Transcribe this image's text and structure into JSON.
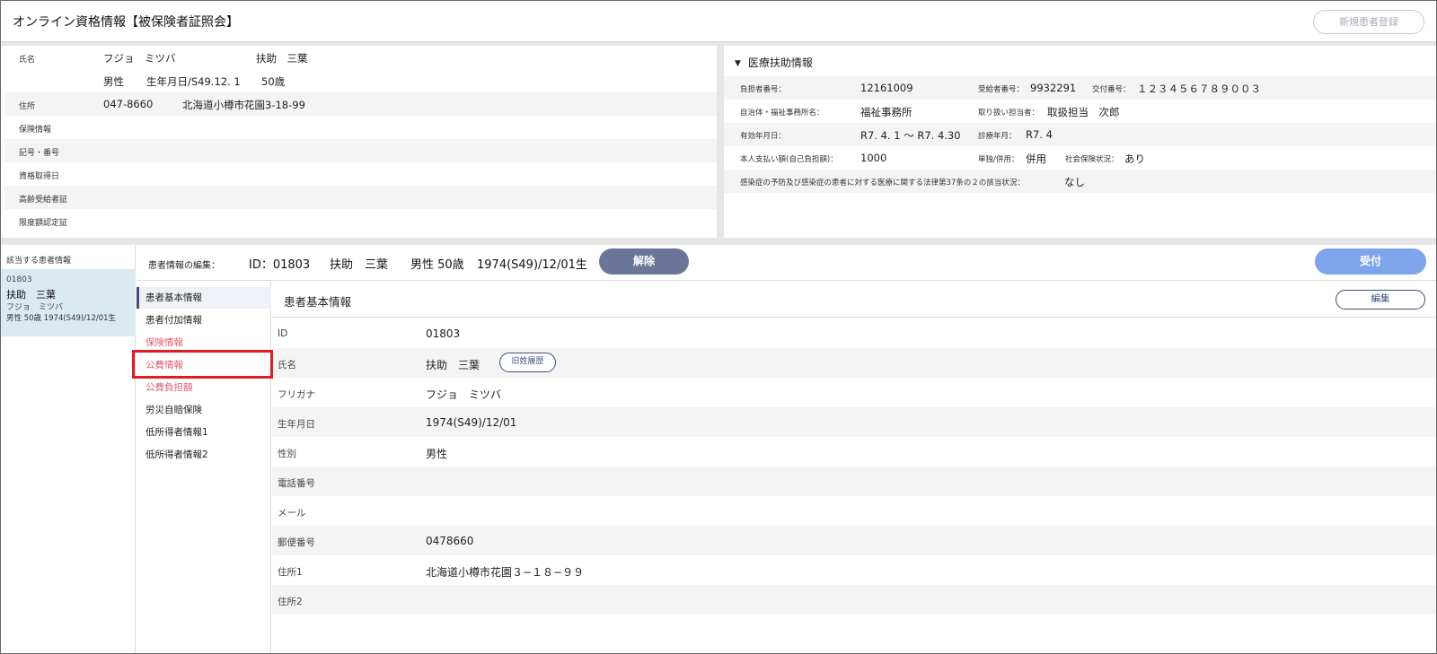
{
  "header": {
    "title": "オンライン資格情報【被保険者証照会】",
    "new_patient_button": "新規患者登録"
  },
  "insured_info": {
    "name_label": "氏名",
    "name_kana": "フジョ　ミツバ",
    "name_kanji": "扶助　三葉",
    "sex": "男性",
    "birth": "生年月日/S49.12. 1",
    "age": "50歳",
    "address_label": "住所",
    "postal": "047-8660",
    "address": "北海道小樽市花園3-18-99",
    "insurance_label": "保険情報",
    "symbol_label": "記号・番号",
    "qualification_label": "資格取得日",
    "elderly_label": "高齢受給者証",
    "limit_label": "限度額認定証"
  },
  "medical_aid": {
    "title": "医療扶助情報",
    "payer_label": "負担者番号：",
    "payer": "12161009",
    "recipient_label": "受給者番号：",
    "recipient": "9932291",
    "issue_label": "交付番号：",
    "issue": "１２３４５６７８９００３",
    "office_label": "自治体・福祉事務所名：",
    "office": "福祉事務所",
    "handler_label": "取り扱い担当者：",
    "handler": "取扱担当　次郎",
    "valid_label": "有効年月日：",
    "valid": "R7. 4. 1 〜 R7. 4.30",
    "treatment_label": "診療年月：",
    "treatment": "R7. 4",
    "self_pay_label": "本人支払い額(自己負担額)：",
    "self_pay": "1000",
    "single_label": "単独/併用：",
    "single": "併用",
    "social_label": "社会保険状況：",
    "social": "あり",
    "infection_label": "感染症の予防及び感染症の患者に対する医療に関する法律第37条の２の該当状況：",
    "infection": "なし"
  },
  "patient_list": {
    "title": "該当する患者情報",
    "card": {
      "id": "01803",
      "name": "扶助　三葉",
      "kana": "フジョ　ミツバ",
      "info": "男性 50歳 1974(S49)/12/01生"
    }
  },
  "edit_bar": {
    "label": "患者情報の編集：",
    "id": "ID：01803",
    "name": "扶助　三葉",
    "sex_age": "男性 50歳",
    "birth": "1974(S49)/12/01生",
    "release_button": "解除",
    "accept_button": "受付"
  },
  "menu": {
    "items": [
      "患者基本情報",
      "患者付加情報",
      "保険情報",
      "公費情報",
      "公費負担額",
      "労災自賠保険",
      "低所得者情報1",
      "低所得者情報2"
    ]
  },
  "content": {
    "title": "患者基本情報",
    "edit_button": "編集",
    "old_name_button": "旧姓履歴",
    "rows": [
      {
        "label": "ID",
        "value": "01803"
      },
      {
        "label": "氏名",
        "value": "扶助　三葉"
      },
      {
        "label": "フリガナ",
        "value": "フジョ　ミツバ"
      },
      {
        "label": "生年月日",
        "value": "1974(S49)/12/01"
      },
      {
        "label": "性別",
        "value": "男性"
      },
      {
        "label": "電話番号",
        "value": ""
      },
      {
        "label": "メール",
        "value": ""
      },
      {
        "label": "郵便番号",
        "value": "0478660"
      },
      {
        "label": "住所1",
        "value": "北海道小樽市花園３−１８−９９"
      },
      {
        "label": "住所2",
        "value": ""
      }
    ]
  },
  "colors": {
    "release_button": "#6a7599",
    "accept_button": "#7ea4ec",
    "active_menu_bar": "#3d4f7a",
    "red_menu_text": "#e06070",
    "highlight_box": "#e01b24",
    "selected_card": "#dbe9f0"
  }
}
